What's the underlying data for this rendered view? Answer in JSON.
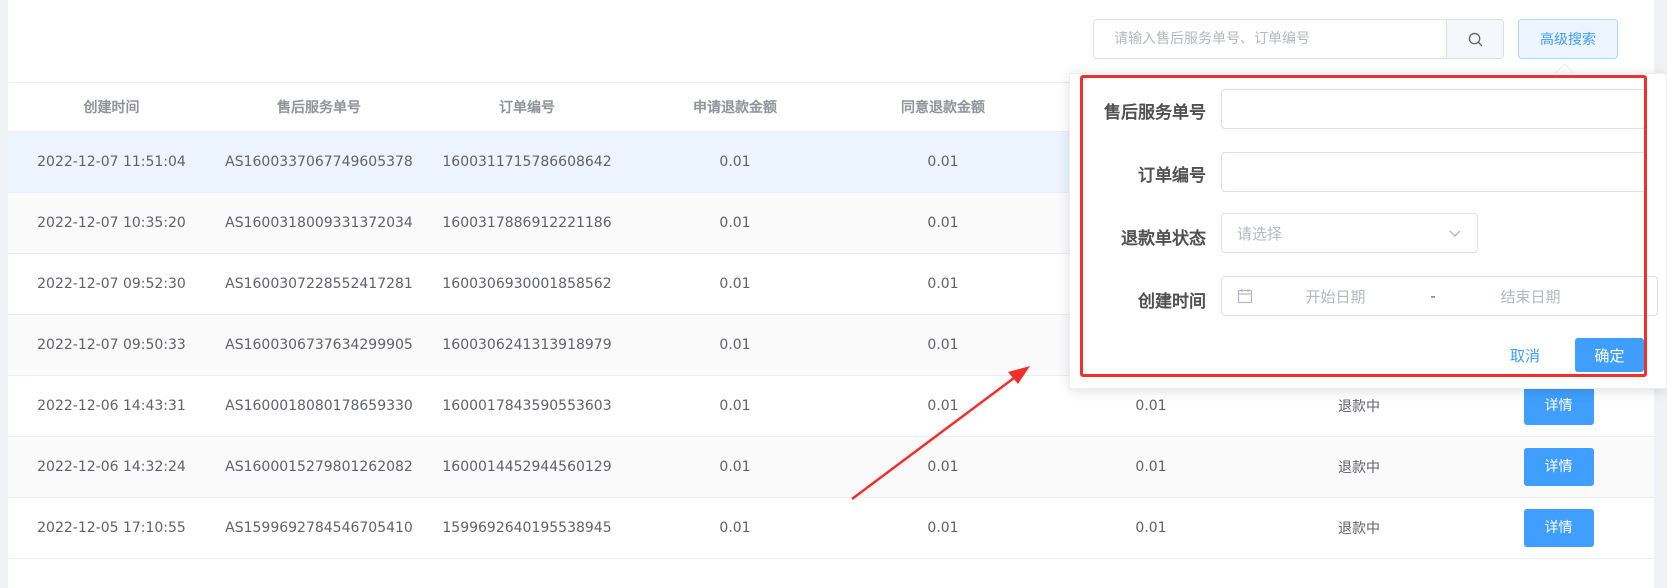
{
  "search": {
    "placeholder": "请输入售后服务单号、订单编号",
    "advanced_label": "高级搜索"
  },
  "icons": {
    "search": "search-icon",
    "calendar": "calendar-icon",
    "chevron": "chevron-down-icon"
  },
  "colors": {
    "primary": "#409eff",
    "highlight": "#f0302c"
  },
  "table": {
    "headers": [
      "创建时间",
      "售后服务单号",
      "订单编号",
      "申请退款金额",
      "同意退款金额"
    ],
    "rows": [
      {
        "created": "2022-12-07 11:51:04",
        "service_no": "AS1600337067749605378",
        "order_no": "1600311715786608642",
        "apply": "0.01",
        "agree": "0.01",
        "agree2": "",
        "status": "",
        "action": ""
      },
      {
        "created": "2022-12-07 10:35:20",
        "service_no": "AS1600318009331372034",
        "order_no": "1600317886912221186",
        "apply": "0.01",
        "agree": "0.01",
        "agree2": "",
        "status": "",
        "action": ""
      },
      {
        "created": "2022-12-07 09:52:30",
        "service_no": "AS1600307228552417281",
        "order_no": "1600306930001858562",
        "apply": "0.01",
        "agree": "0.01",
        "agree2": "",
        "status": "",
        "action": ""
      },
      {
        "created": "2022-12-07 09:50:33",
        "service_no": "AS1600306737634299905",
        "order_no": "1600306241313918979",
        "apply": "0.01",
        "agree": "0.01",
        "agree2": "",
        "status": "",
        "action": ""
      },
      {
        "created": "2022-12-06 14:43:31",
        "service_no": "AS1600018080178659330",
        "order_no": "1600017843590553603",
        "apply": "0.01",
        "agree": "0.01",
        "agree2": "0.01",
        "status": "退款中",
        "action": "详情"
      },
      {
        "created": "2022-12-06 14:32:24",
        "service_no": "AS1600015279801262082",
        "order_no": "1600014452944560129",
        "apply": "0.01",
        "agree": "0.01",
        "agree2": "0.01",
        "status": "退款中",
        "action": "详情"
      },
      {
        "created": "2022-12-05 17:10:55",
        "service_no": "AS1599692784546705410",
        "order_no": "1599692640195538945",
        "apply": "0.01",
        "agree": "0.01",
        "agree2": "0.01",
        "status": "退款中",
        "action": "详情"
      }
    ]
  },
  "popover": {
    "labels": {
      "service_no": "售后服务单号",
      "order_no": "订单编号",
      "status": "退款单状态",
      "created": "创建时间"
    },
    "status_placeholder": "请选择",
    "start_placeholder": "开始日期",
    "range_separator": "-",
    "end_placeholder": "结束日期",
    "cancel_label": "取消",
    "confirm_label": "确定"
  }
}
